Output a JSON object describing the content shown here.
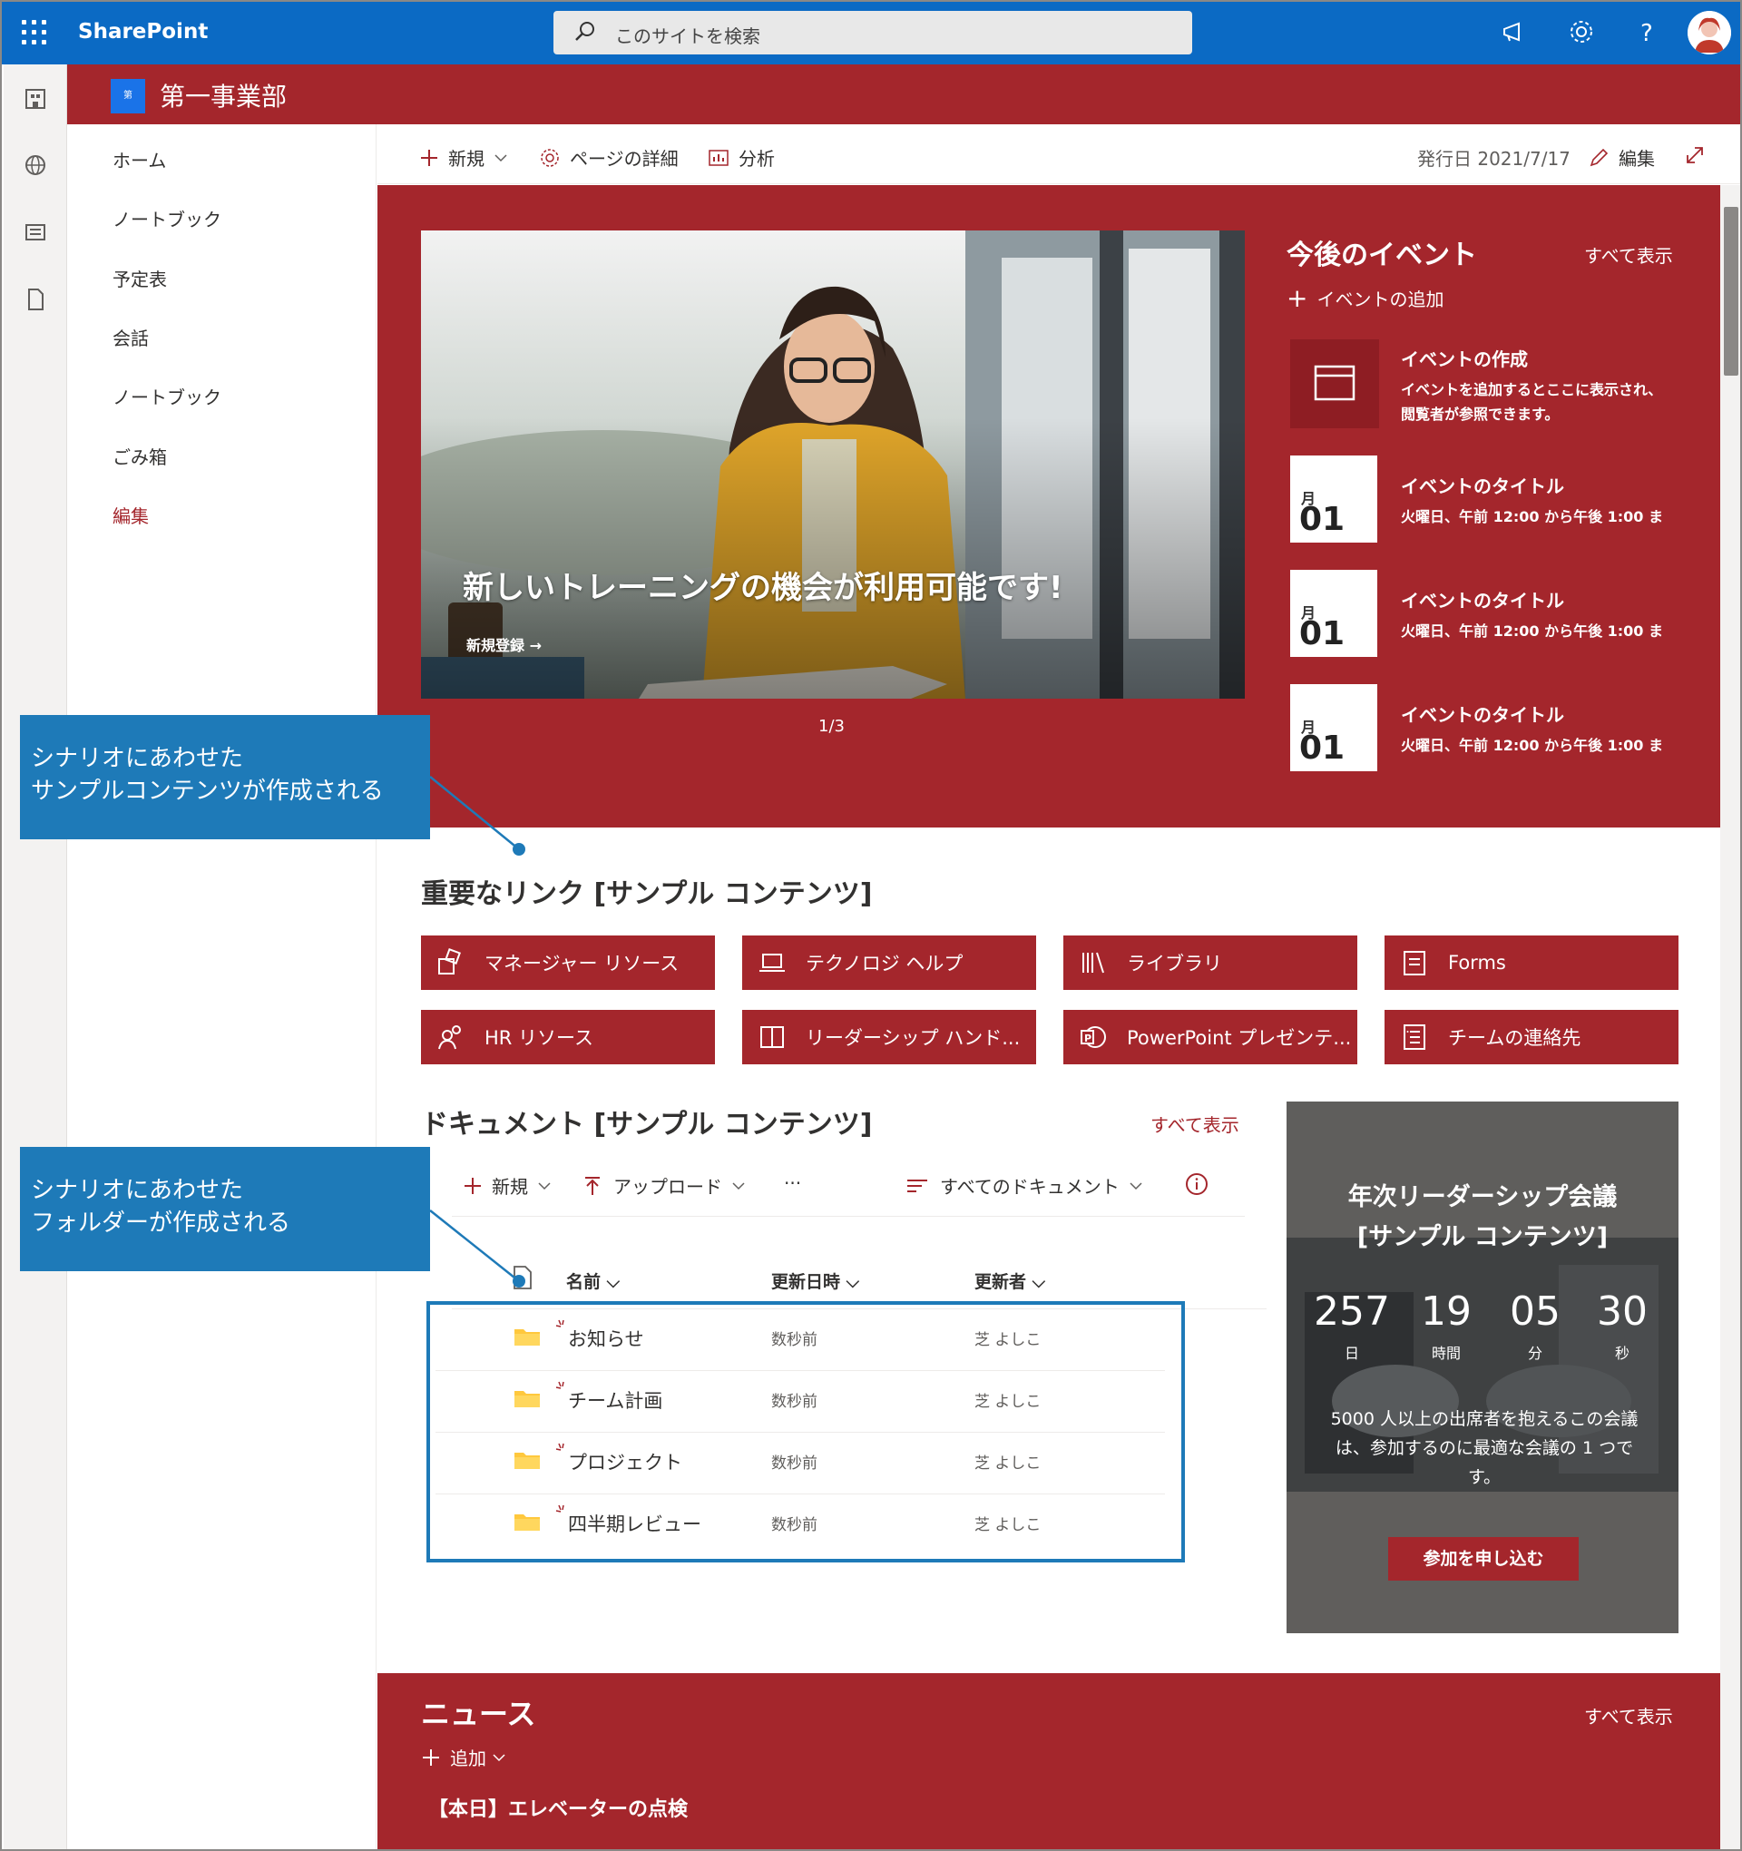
{
  "suite": {
    "app_name": "SharePoint",
    "search_placeholder": "このサイトを検索"
  },
  "site": {
    "title": "第一事業部",
    "logo_text": "第"
  },
  "nav": [
    "ホーム",
    "ノートブック",
    "予定表",
    "会話",
    "ノートブック",
    "ごみ箱"
  ],
  "nav_edit": "編集",
  "command_bar": {
    "new": "新規",
    "page_details": "ページの詳細",
    "analytics": "分析",
    "published": "発行日 2021/7/17",
    "edit": "編集"
  },
  "hero": {
    "title": "新しいトレーニングの機会が利用可能です!",
    "link": "新規登録",
    "pager": "1/3"
  },
  "events": {
    "heading": "今後のイベント",
    "see_all": "すべて表示",
    "add": "イベントの追加",
    "create_title": "イベントの作成",
    "create_desc": "イベントを追加するとここに表示され、閲覧者が参照できます。",
    "items": [
      {
        "month": "月",
        "day": "01",
        "title": "イベントのタイトル",
        "time": "火曜日、午前 12:00 から午後 1:00 ま"
      },
      {
        "month": "月",
        "day": "01",
        "title": "イベントのタイトル",
        "time": "火曜日、午前 12:00 から午後 1:00 ま"
      },
      {
        "month": "月",
        "day": "01",
        "title": "イベントのタイトル",
        "time": "火曜日、午前 12:00 から午後 1:00 ま"
      }
    ]
  },
  "callouts": {
    "first": [
      "シナリオにあわせた",
      "サンプルコンテンツが作成される"
    ],
    "second": [
      "シナリオにあわせた",
      "フォルダーが作成される"
    ]
  },
  "quick_links": {
    "heading": "重要なリンク [サンプル コンテンツ]",
    "items": [
      {
        "label": "マネージャー リソース",
        "icon": "shapes-icon"
      },
      {
        "label": "テクノロジ ヘルプ",
        "icon": "laptop-icon"
      },
      {
        "label": "ライブラリ",
        "icon": "library-icon"
      },
      {
        "label": "Forms",
        "icon": "forms-icon"
      },
      {
        "label": "HR リソース",
        "icon": "people-icon"
      },
      {
        "label": "リーダーシップ ハンド...",
        "icon": "book-icon"
      },
      {
        "label": "PowerPoint プレゼンテ...",
        "icon": "powerpoint-icon"
      },
      {
        "label": "チームの連絡先",
        "icon": "contact-list-icon"
      }
    ]
  },
  "documents": {
    "heading": "ドキュメント [サンプル コンテンツ]",
    "see_all": "すべて表示",
    "new": "新規",
    "upload": "アップロード",
    "more": "···",
    "view": "すべてのドキュメント",
    "columns": {
      "name": "名前",
      "modified": "更新日時",
      "modified_by": "更新者"
    },
    "rows": [
      {
        "name": "お知らせ",
        "modified": "数秒前",
        "by": "芝 よしこ"
      },
      {
        "name": "チーム計画",
        "modified": "数秒前",
        "by": "芝 よしこ"
      },
      {
        "name": "プロジェクト",
        "modified": "数秒前",
        "by": "芝 よしこ"
      },
      {
        "name": "四半期レビュー",
        "modified": "数秒前",
        "by": "芝 よしこ"
      }
    ]
  },
  "countdown": {
    "title_line1": "年次リーダーシップ会議",
    "title_line2": "[サンプル コンテンツ]",
    "values": [
      {
        "num": "257",
        "unit": "日"
      },
      {
        "num": "19",
        "unit": "時間"
      },
      {
        "num": "05",
        "unit": "分"
      },
      {
        "num": "30",
        "unit": "秒"
      }
    ],
    "desc": "5000 人以上の出席者を抱えるこの会議は、参加するのに最適な会議の 1 つです。",
    "button": "参加を申し込む"
  },
  "news": {
    "heading": "ニュース",
    "see_all": "すべて表示",
    "add": "追加",
    "item": "【本日】エレベーターの点検"
  },
  "colors": {
    "suite_blue": "#0b6ac4",
    "theme_red": "#a4262c",
    "callout_blue": "#1e7ab8"
  }
}
